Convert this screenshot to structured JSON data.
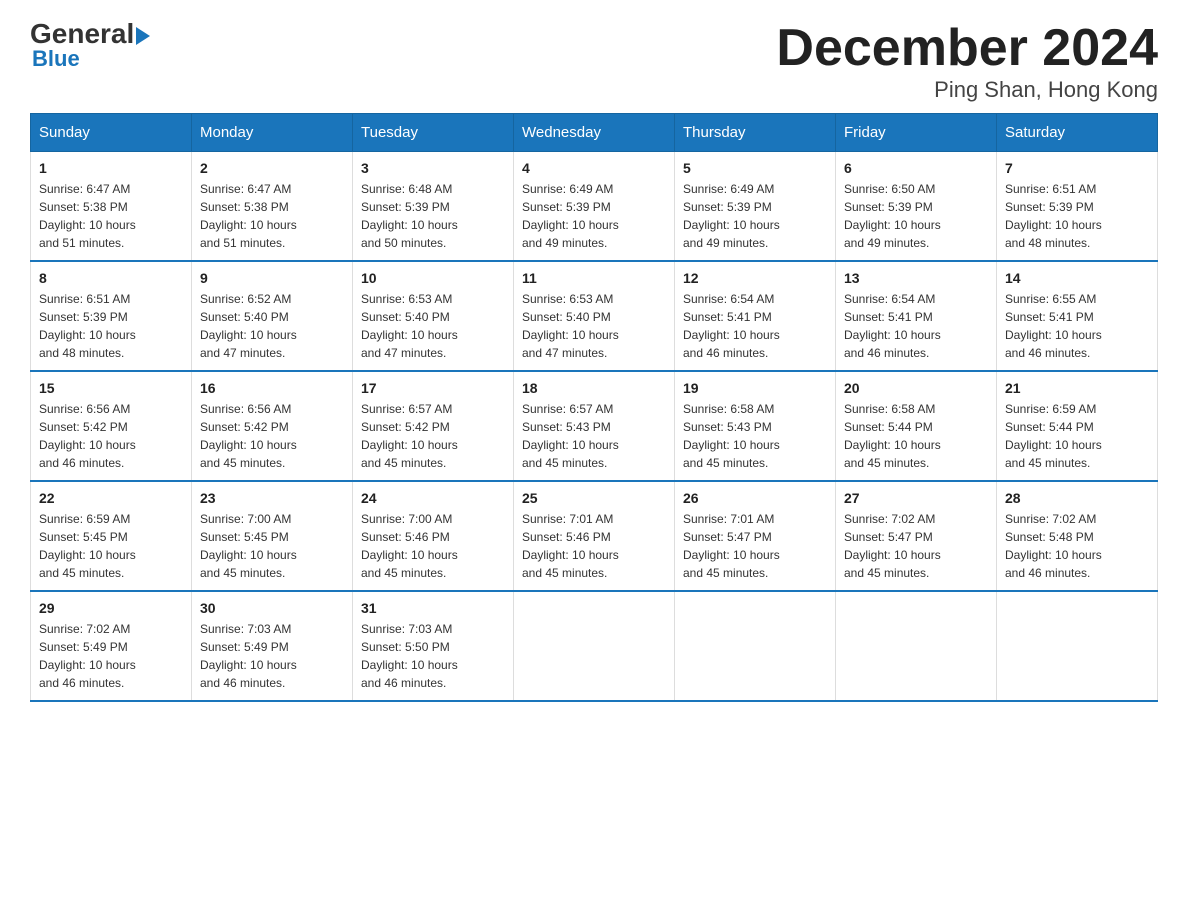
{
  "logo": {
    "part1": "General",
    "part2": "Blue"
  },
  "title": "December 2024",
  "subtitle": "Ping Shan, Hong Kong",
  "weekdays": [
    "Sunday",
    "Monday",
    "Tuesday",
    "Wednesday",
    "Thursday",
    "Friday",
    "Saturday"
  ],
  "weeks": [
    [
      {
        "day": "1",
        "sunrise": "6:47 AM",
        "sunset": "5:38 PM",
        "daylight": "10 hours and 51 minutes."
      },
      {
        "day": "2",
        "sunrise": "6:47 AM",
        "sunset": "5:38 PM",
        "daylight": "10 hours and 51 minutes."
      },
      {
        "day": "3",
        "sunrise": "6:48 AM",
        "sunset": "5:39 PM",
        "daylight": "10 hours and 50 minutes."
      },
      {
        "day": "4",
        "sunrise": "6:49 AM",
        "sunset": "5:39 PM",
        "daylight": "10 hours and 49 minutes."
      },
      {
        "day": "5",
        "sunrise": "6:49 AM",
        "sunset": "5:39 PM",
        "daylight": "10 hours and 49 minutes."
      },
      {
        "day": "6",
        "sunrise": "6:50 AM",
        "sunset": "5:39 PM",
        "daylight": "10 hours and 49 minutes."
      },
      {
        "day": "7",
        "sunrise": "6:51 AM",
        "sunset": "5:39 PM",
        "daylight": "10 hours and 48 minutes."
      }
    ],
    [
      {
        "day": "8",
        "sunrise": "6:51 AM",
        "sunset": "5:39 PM",
        "daylight": "10 hours and 48 minutes."
      },
      {
        "day": "9",
        "sunrise": "6:52 AM",
        "sunset": "5:40 PM",
        "daylight": "10 hours and 47 minutes."
      },
      {
        "day": "10",
        "sunrise": "6:53 AM",
        "sunset": "5:40 PM",
        "daylight": "10 hours and 47 minutes."
      },
      {
        "day": "11",
        "sunrise": "6:53 AM",
        "sunset": "5:40 PM",
        "daylight": "10 hours and 47 minutes."
      },
      {
        "day": "12",
        "sunrise": "6:54 AM",
        "sunset": "5:41 PM",
        "daylight": "10 hours and 46 minutes."
      },
      {
        "day": "13",
        "sunrise": "6:54 AM",
        "sunset": "5:41 PM",
        "daylight": "10 hours and 46 minutes."
      },
      {
        "day": "14",
        "sunrise": "6:55 AM",
        "sunset": "5:41 PM",
        "daylight": "10 hours and 46 minutes."
      }
    ],
    [
      {
        "day": "15",
        "sunrise": "6:56 AM",
        "sunset": "5:42 PM",
        "daylight": "10 hours and 46 minutes."
      },
      {
        "day": "16",
        "sunrise": "6:56 AM",
        "sunset": "5:42 PM",
        "daylight": "10 hours and 45 minutes."
      },
      {
        "day": "17",
        "sunrise": "6:57 AM",
        "sunset": "5:42 PM",
        "daylight": "10 hours and 45 minutes."
      },
      {
        "day": "18",
        "sunrise": "6:57 AM",
        "sunset": "5:43 PM",
        "daylight": "10 hours and 45 minutes."
      },
      {
        "day": "19",
        "sunrise": "6:58 AM",
        "sunset": "5:43 PM",
        "daylight": "10 hours and 45 minutes."
      },
      {
        "day": "20",
        "sunrise": "6:58 AM",
        "sunset": "5:44 PM",
        "daylight": "10 hours and 45 minutes."
      },
      {
        "day": "21",
        "sunrise": "6:59 AM",
        "sunset": "5:44 PM",
        "daylight": "10 hours and 45 minutes."
      }
    ],
    [
      {
        "day": "22",
        "sunrise": "6:59 AM",
        "sunset": "5:45 PM",
        "daylight": "10 hours and 45 minutes."
      },
      {
        "day": "23",
        "sunrise": "7:00 AM",
        "sunset": "5:45 PM",
        "daylight": "10 hours and 45 minutes."
      },
      {
        "day": "24",
        "sunrise": "7:00 AM",
        "sunset": "5:46 PM",
        "daylight": "10 hours and 45 minutes."
      },
      {
        "day": "25",
        "sunrise": "7:01 AM",
        "sunset": "5:46 PM",
        "daylight": "10 hours and 45 minutes."
      },
      {
        "day": "26",
        "sunrise": "7:01 AM",
        "sunset": "5:47 PM",
        "daylight": "10 hours and 45 minutes."
      },
      {
        "day": "27",
        "sunrise": "7:02 AM",
        "sunset": "5:47 PM",
        "daylight": "10 hours and 45 minutes."
      },
      {
        "day": "28",
        "sunrise": "7:02 AM",
        "sunset": "5:48 PM",
        "daylight": "10 hours and 46 minutes."
      }
    ],
    [
      {
        "day": "29",
        "sunrise": "7:02 AM",
        "sunset": "5:49 PM",
        "daylight": "10 hours and 46 minutes."
      },
      {
        "day": "30",
        "sunrise": "7:03 AM",
        "sunset": "5:49 PM",
        "daylight": "10 hours and 46 minutes."
      },
      {
        "day": "31",
        "sunrise": "7:03 AM",
        "sunset": "5:50 PM",
        "daylight": "10 hours and 46 minutes."
      },
      null,
      null,
      null,
      null
    ]
  ],
  "labels": {
    "sunrise": "Sunrise:",
    "sunset": "Sunset:",
    "daylight": "Daylight:"
  }
}
